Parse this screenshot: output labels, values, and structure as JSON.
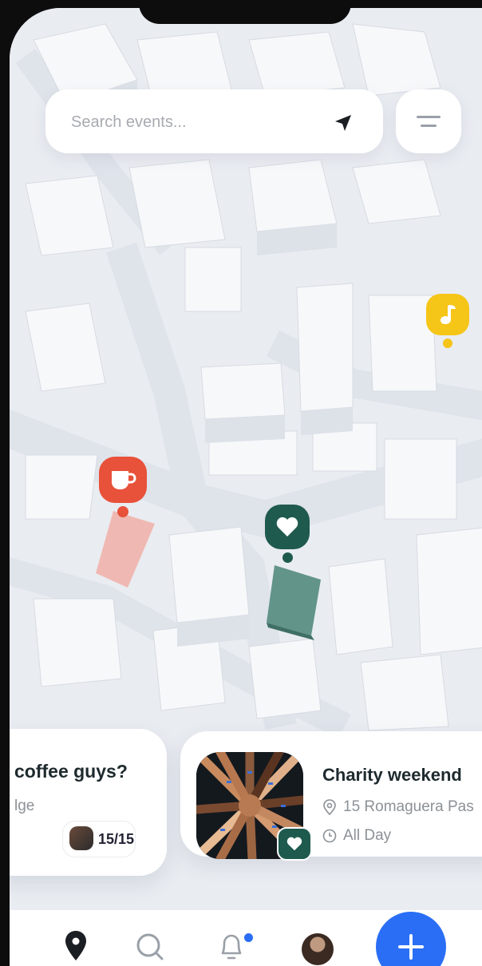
{
  "search": {
    "placeholder": "Search events..."
  },
  "icons": {
    "navigate": "navigation-arrow-icon",
    "filter": "filter-icon",
    "music": "music-note-icon",
    "coffee": "coffee-cup-icon",
    "heart": "heart-icon",
    "location": "location-pin-icon",
    "clock": "clock-icon",
    "map_tab": "map-pin-icon",
    "search_tab": "search-icon",
    "notifications_tab": "bell-icon",
    "add": "plus-icon"
  },
  "colors": {
    "music_pin": "#f5c518",
    "coffee_pin": "#e8513a",
    "heart_pin": "#1f5a4e",
    "accent": "#2a6ef5"
  },
  "cards": [
    {
      "title": "coffee guys?",
      "location": "lge",
      "attendees": "15/15"
    },
    {
      "title": "Charity weekend",
      "location": "15 Romaguera Pas",
      "time": "All Day"
    }
  ]
}
